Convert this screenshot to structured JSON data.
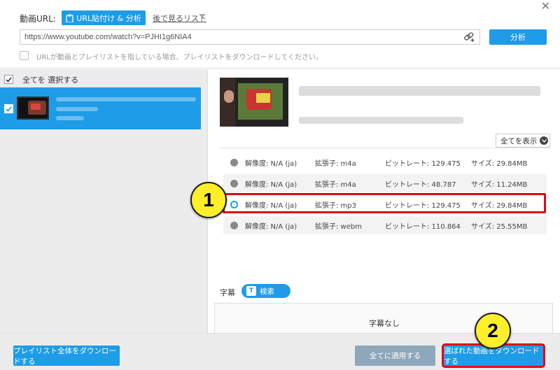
{
  "header": {
    "url_label": "動画URL:",
    "paste_button": "URL貼付け & 分析",
    "watch_later": "後で見るリスト",
    "url_value": "https://www.youtube.com/watch?v=PJHI1g6NIA4",
    "analyze_button": "分析",
    "playlist_note": "URLが動画とプレイリストを指している場合、プレイリストをダウンロードしてください。"
  },
  "left_panel": {
    "select_all_label": "全てを 選択する"
  },
  "right_panel": {
    "show_all_label": "全てを表示",
    "formats": [
      {
        "resolution": "解像度: N/A (ja)",
        "extension": "拡張子: m4a",
        "bitrate": "ビットレート: 129.475",
        "size": "サイズ: 29.84MB",
        "selected": false
      },
      {
        "resolution": "解像度: N/A (ja)",
        "extension": "拡張子: m4a",
        "bitrate": "ビットレート: 48.787",
        "size": "サイズ: 11.24MB",
        "selected": false
      },
      {
        "resolution": "解像度: N/A (ja)",
        "extension": "拡張子: mp3",
        "bitrate": "ビットレート: 129.475",
        "size": "サイズ: 29.84MB",
        "selected": true
      },
      {
        "resolution": "解像度: N/A (ja)",
        "extension": "拡張子: webm",
        "bitrate": "ビットレート: 110.864",
        "size": "サイズ: 25.55MB",
        "selected": false
      }
    ],
    "subtitle_label": "字幕",
    "subtitle_search": "検索",
    "subtitle_search_icon_text": "T",
    "no_subtitles": "字幕なし"
  },
  "annotations": {
    "step1": "1",
    "step2": "2",
    "highlight_color": "#e30613",
    "badge_color": "#ffef2b"
  },
  "footer": {
    "download_playlist": "プレイリスト全体をダウンロードする",
    "apply_all": "全てに適用する",
    "download_selected": "選ばれた動画をダウンロードする"
  },
  "colors": {
    "accent": "#1e9ce8",
    "disabled_button": "#8fa7bb"
  }
}
